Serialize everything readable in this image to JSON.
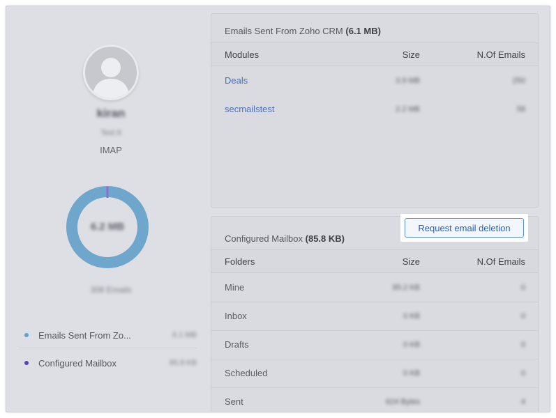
{
  "profile": {
    "name": "kiran",
    "subtitle": "Test 8",
    "account_type": "IMAP",
    "avatar_icon": "user-silhouette-icon"
  },
  "summary": {
    "total_size": "6.2 MB",
    "email_count": "308 Emails",
    "colors": {
      "ring": "#6fa6cb",
      "crm": "#5aa1d4",
      "mailbox": "#5a3fb8"
    },
    "breakdown": [
      {
        "label": "Emails Sent From Zo...",
        "value": "6.1 MB",
        "color": "#5aa1d4"
      },
      {
        "label": "Configured Mailbox",
        "value": "85.8 KB",
        "color": "#5a3fb8"
      }
    ]
  },
  "crm_card": {
    "title": "Emails Sent From Zoho CRM",
    "size": "(6.1 MB)",
    "columns": [
      "Modules",
      "Size",
      "N.Of Emails"
    ],
    "rows": [
      {
        "module": "Deals",
        "size": "3.9 MB",
        "count": "250"
      },
      {
        "module": "secmailstest",
        "size": "2.2 MB",
        "count": "58"
      }
    ]
  },
  "mailbox_card": {
    "title": "Configured Mailbox",
    "size": "(85.8 KB)",
    "action_label": "Request email deletion",
    "columns": [
      "Folders",
      "Size",
      "N.Of Emails"
    ],
    "rows": [
      {
        "folder": "Mine",
        "size": "85.2 KB",
        "count": "0"
      },
      {
        "folder": "Inbox",
        "size": "0 KB",
        "count": "0"
      },
      {
        "folder": "Drafts",
        "size": "0 KB",
        "count": "0"
      },
      {
        "folder": "Scheduled",
        "size": "0 KB",
        "count": "0"
      },
      {
        "folder": "Sent",
        "size": "624 Bytes",
        "count": "4"
      }
    ]
  }
}
